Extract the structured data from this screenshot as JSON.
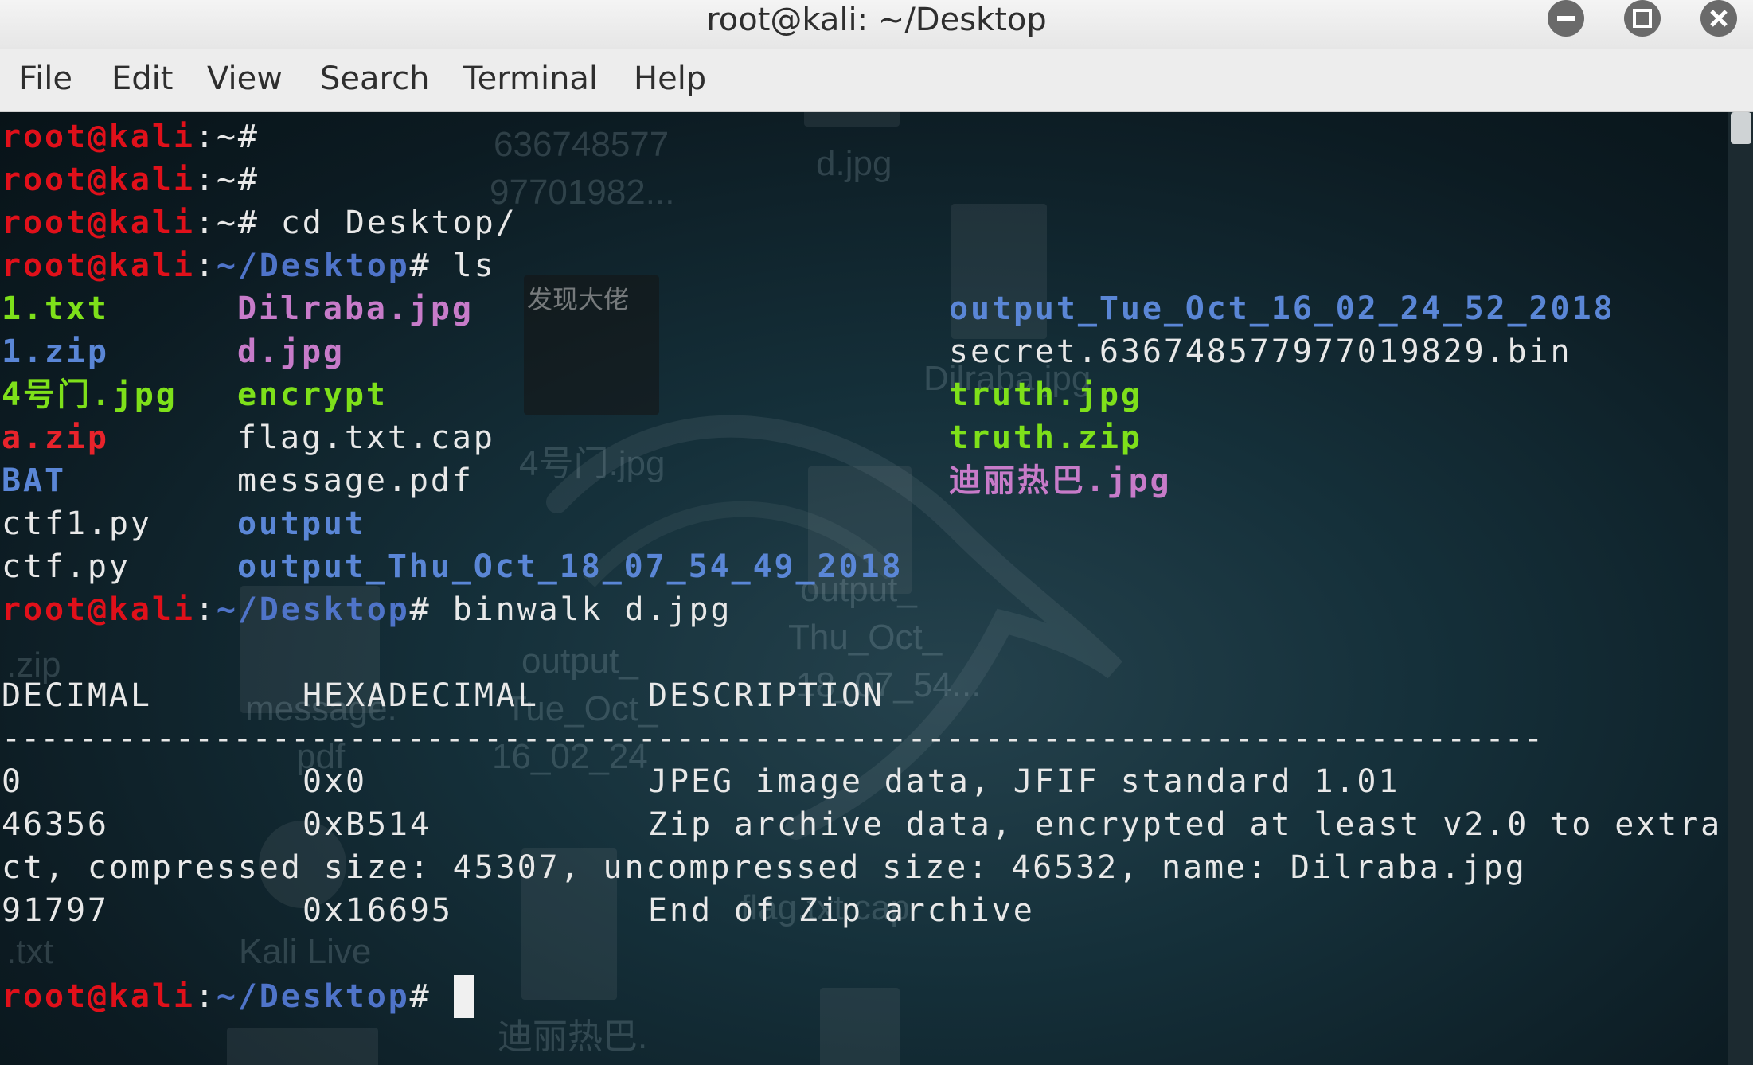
{
  "window": {
    "title": "root@kali: ~/Desktop",
    "buttons": [
      "minimize",
      "maximize",
      "close"
    ]
  },
  "menu": [
    "File",
    "Edit",
    "View",
    "Search",
    "Terminal",
    "Help"
  ],
  "prompt": {
    "user": "root@kali",
    "sep": ":",
    "home": "~",
    "desktop": "~/Desktop",
    "hash": "#"
  },
  "commands": {
    "cd": " cd Desktop/",
    "ls": " ls",
    "binwalk": " binwalk d.jpg"
  },
  "ls_listing": [
    [
      {
        "name": "1.txt",
        "type": "exe"
      },
      {
        "name": "1.zip",
        "type": "dir"
      },
      {
        "name": "4号门.jpg",
        "type": "exe"
      },
      {
        "name": "a.zip",
        "type": "arc"
      },
      {
        "name": "BAT",
        "type": "dir"
      },
      {
        "name": "ctf1.py",
        "type": "file"
      },
      {
        "name": "ctf.py",
        "type": "file"
      }
    ],
    [
      {
        "name": "Dilraba.jpg",
        "type": "img"
      },
      {
        "name": "d.jpg",
        "type": "img"
      },
      {
        "name": "encrypt",
        "type": "exe"
      },
      {
        "name": "flag.txt.cap",
        "type": "file"
      },
      {
        "name": "message.pdf",
        "type": "file"
      },
      {
        "name": "output",
        "type": "dir"
      },
      {
        "name": "output_Thu_Oct_18_07_54_49_2018",
        "type": "dir"
      }
    ],
    [
      {
        "name": "output_Tue_Oct_16_02_24_52_2018",
        "type": "dir"
      },
      {
        "name": "secret.636748577977019829.bin",
        "type": "file"
      },
      {
        "name": "truth.jpg",
        "type": "exe"
      },
      {
        "name": "truth.zip",
        "type": "exe"
      },
      {
        "name": "迪丽热巴.jpg",
        "type": "img"
      }
    ]
  ],
  "binwalk": {
    "headers": [
      "DECIMAL",
      "HEXADECIMAL",
      "DESCRIPTION"
    ],
    "separator": "--------------------------------------------------------------------------------",
    "rows": [
      {
        "decimal": "0",
        "hex": "0x0",
        "desc": "JPEG image data, JFIF standard 1.01"
      },
      {
        "decimal": "46356",
        "hex": "0xB514",
        "desc": "Zip archive data, encrypted at least v2.0 to extra"
      },
      {
        "decimal": "",
        "hex": "",
        "desc": "ct, compressed size: 45307, uncompressed size: 46532, name: Dilraba.jpg"
      },
      {
        "decimal": "91797",
        "hex": "0x16695",
        "desc": "End of Zip archive"
      }
    ]
  },
  "desktop_icons": [
    "636748577",
    "97701982...",
    "d.jpg",
    "Dilraba.jpg",
    "4号门.jpg",
    "output_",
    "Thu_Oct_",
    "18_07_54...",
    "output_",
    "Tue_Oct_",
    "16_02_24",
    "message.",
    "pdf",
    ".zip",
    ".txt",
    "Kali Live",
    "flag.txt.cap",
    "迪丽热巴.",
    "发现大佬"
  ]
}
